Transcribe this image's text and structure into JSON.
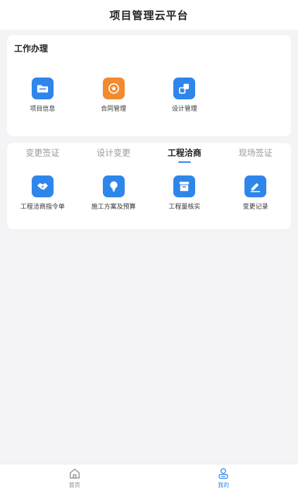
{
  "header": {
    "title": "项目管理云平台"
  },
  "work_section": {
    "title": "工作办理",
    "items": [
      {
        "label": "项目信息",
        "icon": "folder-icon",
        "color": "#2f86ea"
      },
      {
        "label": "合同管理",
        "icon": "medal-icon",
        "color": "#f28a2e"
      },
      {
        "label": "设计管理",
        "icon": "squares-icon",
        "color": "#2f86ea"
      }
    ]
  },
  "tabs": {
    "items": [
      "变更签证",
      "设计变更",
      "工程洽商",
      "现场签证"
    ],
    "active_index": 2
  },
  "tab_content": {
    "items": [
      {
        "label": "工程洽商指令单",
        "icon": "handshake-icon",
        "color": "#2f86ea"
      },
      {
        "label": "施工方案及预算",
        "icon": "lightbulb-icon",
        "color": "#2f86ea"
      },
      {
        "label": "工程量核实",
        "icon": "archive-box-icon",
        "color": "#2f86ea"
      },
      {
        "label": "变更记录",
        "icon": "edit-icon",
        "color": "#2f86ea"
      }
    ]
  },
  "bottom_nav": {
    "items": [
      {
        "label": "首页",
        "icon": "home-icon"
      },
      {
        "label": "我的",
        "icon": "user-icon"
      }
    ],
    "active_index": 1,
    "active_color": "#2f86ea"
  }
}
